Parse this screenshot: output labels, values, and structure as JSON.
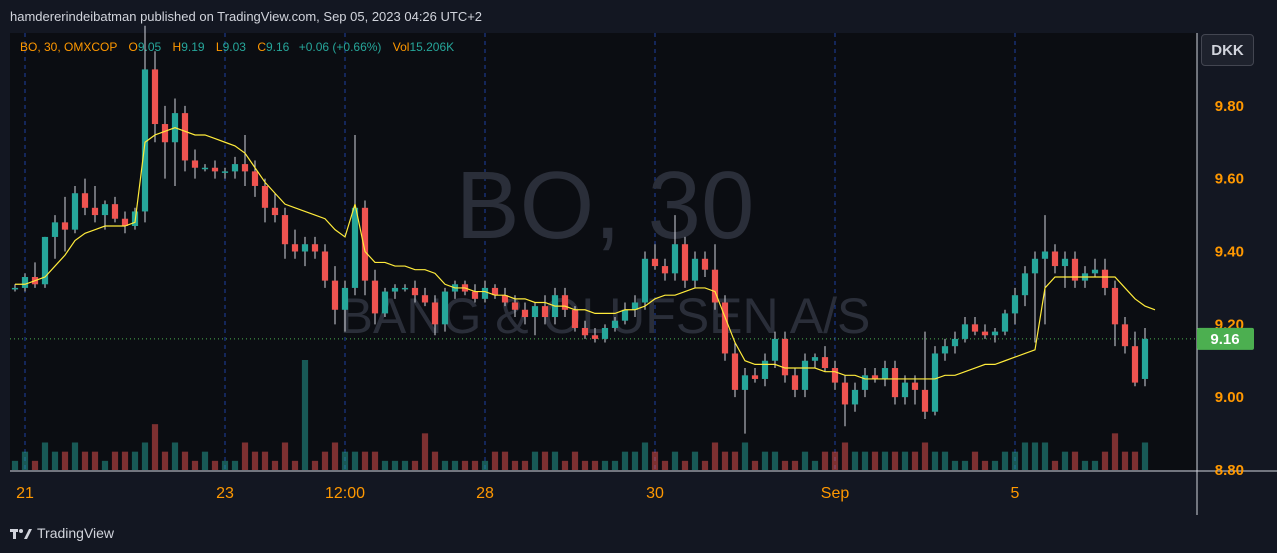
{
  "header": {
    "published": "hamdererindeibatman published on TradingView.com, Sep 05, 2023 04:26 UTC+2"
  },
  "footer": {
    "brand": "TradingView"
  },
  "currency": "DKK",
  "legend": {
    "symbol": "BO, 30, OMXCOP",
    "o_label": "O",
    "o_value": "9.05",
    "h_label": "H",
    "h_value": "9.19",
    "l_label": "L",
    "l_value": "9.03",
    "c_label": "C",
    "c_value": "9.16",
    "change": "+0.06 (+0.66%)",
    "vol_label": "Vol",
    "vol_value": "15.206K"
  },
  "watermark": {
    "line1": "BO, 30",
    "line2": "BANG & OLUFSEN A/S"
  },
  "colors": {
    "up": "#26a69a",
    "down": "#ef5350",
    "ma": "#ffeb3b",
    "accent": "#ff9800",
    "last_price_bg": "#4caf50"
  },
  "chart_data": {
    "type": "candlestick",
    "ylim": [
      8.8,
      10.0
    ],
    "y_ticks": [
      "9.00",
      "9.20",
      "9.40",
      "9.60",
      "9.80",
      "8.80"
    ],
    "x_ticks": [
      "21",
      "23",
      "12:00",
      "28",
      "30",
      "Sep",
      "5"
    ],
    "last_price": 9.16,
    "last_price_label": "9.16",
    "candles": [
      [
        9.3,
        9.31,
        9.29,
        9.3,
        1
      ],
      [
        9.3,
        9.34,
        9.29,
        9.33,
        2
      ],
      [
        9.33,
        9.37,
        9.3,
        9.31,
        1
      ],
      [
        9.31,
        9.44,
        9.3,
        9.44,
        3
      ],
      [
        9.44,
        9.5,
        9.38,
        9.48,
        2
      ],
      [
        9.48,
        9.55,
        9.4,
        9.46,
        2
      ],
      [
        9.46,
        9.58,
        9.45,
        9.56,
        3
      ],
      [
        9.56,
        9.6,
        9.5,
        9.52,
        2
      ],
      [
        9.52,
        9.58,
        9.48,
        9.5,
        2
      ],
      [
        9.5,
        9.54,
        9.46,
        9.53,
        1
      ],
      [
        9.53,
        9.55,
        9.48,
        9.49,
        2
      ],
      [
        9.49,
        9.51,
        9.45,
        9.47,
        2
      ],
      [
        9.47,
        9.52,
        9.46,
        9.51,
        2
      ],
      [
        9.51,
        10.02,
        9.48,
        9.9,
        3
      ],
      [
        9.9,
        9.95,
        9.7,
        9.75,
        5
      ],
      [
        9.75,
        9.8,
        9.6,
        9.7,
        2
      ],
      [
        9.7,
        9.82,
        9.58,
        9.78,
        3
      ],
      [
        9.78,
        9.8,
        9.62,
        9.65,
        2
      ],
      [
        9.65,
        9.68,
        9.6,
        9.63,
        1
      ],
      [
        9.63,
        9.64,
        9.62,
        9.63,
        2
      ],
      [
        9.63,
        9.65,
        9.6,
        9.62,
        1
      ],
      [
        9.62,
        9.63,
        9.6,
        9.62,
        1
      ],
      [
        9.62,
        9.66,
        9.6,
        9.64,
        1
      ],
      [
        9.64,
        9.72,
        9.58,
        9.62,
        3
      ],
      [
        9.62,
        9.65,
        9.55,
        9.58,
        2
      ],
      [
        9.58,
        9.6,
        9.48,
        9.52,
        2
      ],
      [
        9.52,
        9.56,
        9.48,
        9.5,
        1
      ],
      [
        9.5,
        9.52,
        9.38,
        9.42,
        3
      ],
      [
        9.42,
        9.46,
        9.38,
        9.4,
        1
      ],
      [
        9.4,
        9.44,
        9.36,
        9.42,
        12
      ],
      [
        9.42,
        9.44,
        9.38,
        9.4,
        1
      ],
      [
        9.4,
        9.42,
        9.3,
        9.32,
        2
      ],
      [
        9.32,
        9.36,
        9.2,
        9.24,
        3
      ],
      [
        9.24,
        9.32,
        9.18,
        9.3,
        2
      ],
      [
        9.3,
        9.72,
        9.28,
        9.52,
        2
      ],
      [
        9.52,
        9.54,
        9.28,
        9.32,
        2
      ],
      [
        9.32,
        9.35,
        9.2,
        9.23,
        2
      ],
      [
        9.23,
        9.3,
        9.22,
        9.29,
        1
      ],
      [
        9.29,
        9.31,
        9.27,
        9.3,
        1
      ],
      [
        9.3,
        9.31,
        9.29,
        9.3,
        1
      ],
      [
        9.3,
        9.32,
        9.26,
        9.28,
        1
      ],
      [
        9.28,
        9.3,
        9.25,
        9.26,
        4
      ],
      [
        9.26,
        9.28,
        9.17,
        9.2,
        2
      ],
      [
        9.2,
        9.3,
        9.18,
        9.29,
        1
      ],
      [
        9.29,
        9.32,
        9.27,
        9.31,
        1
      ],
      [
        9.31,
        9.32,
        9.28,
        9.29,
        1
      ],
      [
        9.29,
        9.31,
        9.26,
        9.27,
        1
      ],
      [
        9.27,
        9.32,
        9.26,
        9.3,
        1
      ],
      [
        9.3,
        9.31,
        9.27,
        9.28,
        2
      ],
      [
        9.28,
        9.3,
        9.25,
        9.26,
        2
      ],
      [
        9.26,
        9.28,
        9.22,
        9.24,
        1
      ],
      [
        9.24,
        9.26,
        9.2,
        9.22,
        1
      ],
      [
        9.22,
        9.26,
        9.17,
        9.25,
        2
      ],
      [
        9.25,
        9.28,
        9.2,
        9.22,
        2
      ],
      [
        9.22,
        9.3,
        9.2,
        9.28,
        2
      ],
      [
        9.28,
        9.3,
        9.22,
        9.24,
        1
      ],
      [
        9.24,
        9.25,
        9.18,
        9.19,
        2
      ],
      [
        9.19,
        9.21,
        9.16,
        9.17,
        1
      ],
      [
        9.17,
        9.19,
        9.15,
        9.16,
        1
      ],
      [
        9.16,
        9.2,
        9.15,
        9.19,
        1
      ],
      [
        9.19,
        9.22,
        9.18,
        9.21,
        1
      ],
      [
        9.21,
        9.26,
        9.2,
        9.24,
        2
      ],
      [
        9.24,
        9.28,
        9.22,
        9.26,
        2
      ],
      [
        9.26,
        9.4,
        9.24,
        9.38,
        3
      ],
      [
        9.38,
        9.42,
        9.35,
        9.36,
        2
      ],
      [
        9.36,
        9.38,
        9.32,
        9.34,
        1
      ],
      [
        9.34,
        9.5,
        9.32,
        9.42,
        2
      ],
      [
        9.42,
        9.44,
        9.3,
        9.32,
        1
      ],
      [
        9.32,
        9.4,
        9.3,
        9.38,
        2
      ],
      [
        9.38,
        9.4,
        9.33,
        9.35,
        1
      ],
      [
        9.35,
        9.42,
        9.24,
        9.26,
        3
      ],
      [
        9.26,
        9.28,
        9.1,
        9.12,
        2
      ],
      [
        9.12,
        9.15,
        9.0,
        9.02,
        2
      ],
      [
        9.02,
        9.08,
        8.9,
        9.06,
        3
      ],
      [
        9.06,
        9.08,
        9.04,
        9.05,
        1
      ],
      [
        9.05,
        9.12,
        9.03,
        9.1,
        2
      ],
      [
        9.1,
        9.18,
        9.08,
        9.16,
        2
      ],
      [
        9.16,
        9.18,
        9.04,
        9.06,
        1
      ],
      [
        9.06,
        9.08,
        9.0,
        9.02,
        1
      ],
      [
        9.02,
        9.12,
        9.0,
        9.1,
        2
      ],
      [
        9.1,
        9.12,
        9.08,
        9.11,
        1
      ],
      [
        9.11,
        9.14,
        9.07,
        9.08,
        2
      ],
      [
        9.08,
        9.1,
        9.02,
        9.04,
        2
      ],
      [
        9.04,
        9.06,
        8.92,
        8.98,
        3
      ],
      [
        8.98,
        9.04,
        8.96,
        9.02,
        2
      ],
      [
        9.02,
        9.08,
        9.0,
        9.06,
        2
      ],
      [
        9.06,
        9.08,
        9.04,
        9.05,
        2
      ],
      [
        9.05,
        9.1,
        9.03,
        9.08,
        2
      ],
      [
        9.08,
        9.1,
        8.98,
        9.0,
        2
      ],
      [
        9.0,
        9.06,
        8.98,
        9.04,
        2
      ],
      [
        9.04,
        9.06,
        8.98,
        9.02,
        2
      ],
      [
        9.02,
        9.18,
        8.94,
        8.96,
        3
      ],
      [
        8.96,
        9.14,
        8.95,
        9.12,
        2
      ],
      [
        9.12,
        9.16,
        9.1,
        9.14,
        2
      ],
      [
        9.14,
        9.18,
        9.12,
        9.16,
        1
      ],
      [
        9.16,
        9.22,
        9.15,
        9.2,
        1
      ],
      [
        9.2,
        9.22,
        9.17,
        9.18,
        2
      ],
      [
        9.18,
        9.2,
        9.16,
        9.17,
        1
      ],
      [
        9.17,
        9.19,
        9.15,
        9.18,
        1
      ],
      [
        9.18,
        9.24,
        9.17,
        9.23,
        2
      ],
      [
        9.23,
        9.3,
        9.2,
        9.28,
        2
      ],
      [
        9.28,
        9.36,
        9.25,
        9.34,
        3
      ],
      [
        9.34,
        9.4,
        9.15,
        9.38,
        3
      ],
      [
        9.38,
        9.5,
        9.2,
        9.4,
        3
      ],
      [
        9.4,
        9.42,
        9.34,
        9.36,
        1
      ],
      [
        9.36,
        9.4,
        9.3,
        9.38,
        2
      ],
      [
        9.38,
        9.4,
        9.3,
        9.32,
        2
      ],
      [
        9.32,
        9.36,
        9.3,
        9.34,
        1
      ],
      [
        9.34,
        9.38,
        9.33,
        9.35,
        1
      ],
      [
        9.35,
        9.38,
        9.28,
        9.3,
        2
      ],
      [
        9.3,
        9.32,
        9.14,
        9.2,
        4
      ],
      [
        9.2,
        9.22,
        9.12,
        9.14,
        2
      ],
      [
        9.14,
        9.18,
        9.03,
        9.04,
        2
      ],
      [
        9.05,
        9.19,
        9.03,
        9.16,
        3
      ]
    ],
    "ma": [
      9.31,
      9.31,
      9.32,
      9.33,
      9.36,
      9.39,
      9.43,
      9.45,
      9.46,
      9.47,
      9.47,
      9.47,
      9.48,
      9.7,
      9.72,
      9.73,
      9.74,
      9.73,
      9.72,
      9.72,
      9.71,
      9.7,
      9.69,
      9.67,
      9.63,
      9.59,
      9.56,
      9.53,
      9.52,
      9.51,
      9.5,
      9.49,
      9.46,
      9.44,
      9.53,
      9.4,
      9.37,
      9.37,
      9.36,
      9.36,
      9.35,
      9.35,
      9.34,
      9.31,
      9.3,
      9.3,
      9.29,
      9.29,
      9.28,
      9.28,
      9.27,
      9.27,
      9.26,
      9.26,
      9.25,
      9.25,
      9.24,
      9.24,
      9.23,
      9.23,
      9.23,
      9.24,
      9.24,
      9.25,
      9.27,
      9.28,
      9.28,
      9.29,
      9.3,
      9.3,
      9.29,
      9.22,
      9.15,
      9.1,
      9.09,
      9.09,
      9.09,
      9.08,
      9.08,
      9.08,
      9.08,
      9.07,
      9.07,
      9.06,
      9.06,
      9.05,
      9.05,
      9.05,
      9.05,
      9.05,
      9.05,
      9.05,
      9.05,
      9.06,
      9.06,
      9.07,
      9.08,
      9.09,
      9.09,
      9.1,
      9.11,
      9.12,
      9.13,
      9.3,
      9.33,
      9.33,
      9.33,
      9.33,
      9.33,
      9.33,
      9.33,
      9.3,
      9.27,
      9.25,
      9.24
    ]
  }
}
